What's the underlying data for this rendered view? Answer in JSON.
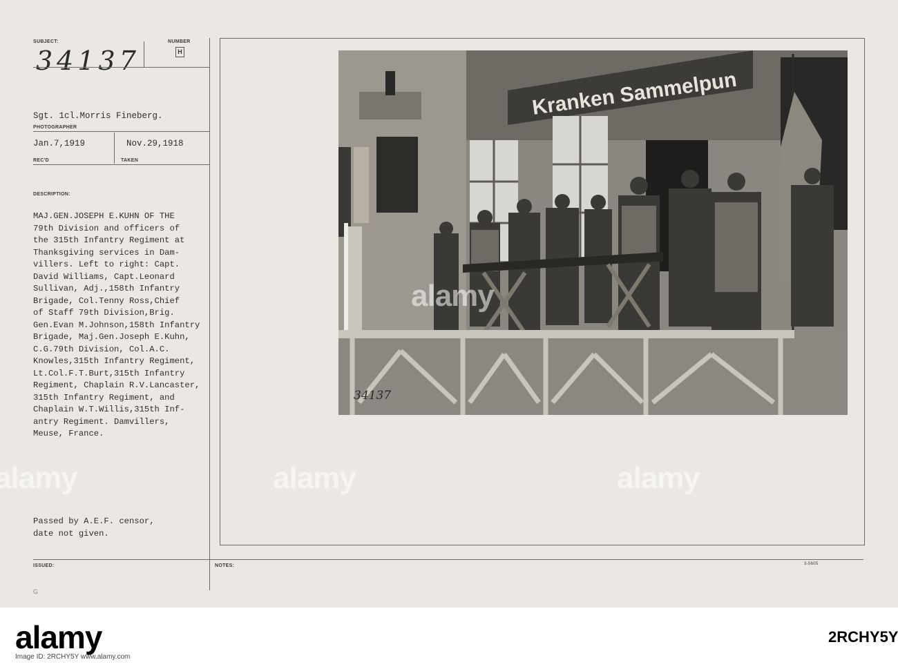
{
  "card": {
    "subject_label": "SUBJECT:",
    "subject_number": "34137",
    "number_label": "NUMBER",
    "number_value": "H",
    "photographer_value": "Sgt. 1cl.Morris Fineberg.",
    "photographer_label": "PHOTOGRAPHER",
    "recd_value": "Jan.7,1919",
    "recd_label": "REC'D",
    "taken_value": "Nov.29,1918",
    "taken_label": "TAKEN",
    "description_label": "DESCRIPTION:",
    "description_lines": [
      "MAJ.GEN.JOSEPH E.KUHN OF THE",
      "79th Division and officers of",
      "the 315th Infantry Regiment at",
      "Thanksgiving services in Dam-",
      "villers. Left to right: Capt.",
      "David Williams, Capt.Leonard",
      "Sullivan, Adj.,158th Infantry",
      "Brigade, Col.Tenny Ross,Chief",
      "of Staff 79th Division,Brig.",
      "Gen.Evan M.Johnson,158th Infantry",
      "Brigade, Maj.Gen.Joseph E.Kuhn,",
      "C.G.79th Division, Col.A.C.",
      "Knowles,315th Infantry Regiment,",
      "Lt.Col.F.T.Burt,315th Infantry",
      "Regiment, Chaplain R.V.Lancaster,",
      "315th Infantry Regiment, and",
      "Chaplain W.T.Willis,315th Inf-",
      "antry Regiment. Damvillers,",
      "Meuse, France."
    ],
    "censor_lines": [
      "Passed by A.E.F. censor,",
      "date not given."
    ],
    "issued_label": "ISSUED:",
    "notes_label": "NOTES:",
    "form_code": "3-5605",
    "corner_mark": "G"
  },
  "photo": {
    "sign_text": "Kranken Sammelpun",
    "negative_number": "34137"
  },
  "watermarks": [
    "alamy",
    "alamy",
    "alamy",
    "alamy"
  ],
  "footer": {
    "logo": "alamy",
    "image_id": "2RCHY5Y",
    "caption": "Image ID: 2RCHY5Y  www.alamy.com"
  }
}
